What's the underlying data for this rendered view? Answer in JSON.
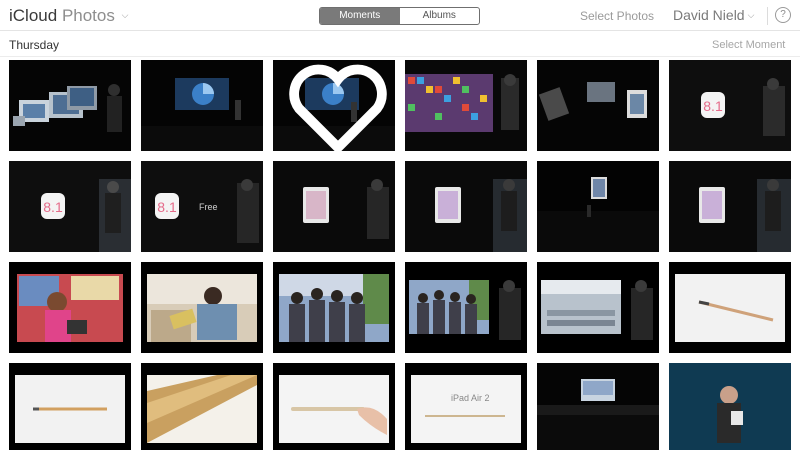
{
  "header": {
    "brand_icloud": "iCloud",
    "brand_app": "Photos",
    "tabs": [
      {
        "label": "Moments",
        "active": true
      },
      {
        "label": "Albums",
        "active": false
      }
    ],
    "select_photos_label": "Select Photos",
    "user_name": "David Nield",
    "help_icon_glyph": "?"
  },
  "moment": {
    "title": "Thursday",
    "select_label": "Select Moment"
  },
  "photos": [
    {
      "desc": "presenter with Mac devices on stage"
    },
    {
      "desc": "stage with blue chart"
    },
    {
      "desc": "stage with blue chart, heart favorite",
      "favorite": true
    },
    {
      "desc": "wall of app icons with presenter"
    },
    {
      "desc": "devices collage with presenter"
    },
    {
      "desc": "iOS 8.1 logo with presenter"
    },
    {
      "desc": "iOS 8.1 logo with presenter"
    },
    {
      "desc": "iOS 8.1 Free",
      "caption": "Free"
    },
    {
      "desc": "iPad with presenter"
    },
    {
      "desc": "iPad with presenter"
    },
    {
      "desc": "wide stage shot with iPad"
    },
    {
      "desc": "iPad with presenter"
    },
    {
      "desc": "child in classroom"
    },
    {
      "desc": "woman on sofa with tablet"
    },
    {
      "desc": "group of people outdoors"
    },
    {
      "desc": "group of people with presenter"
    },
    {
      "desc": "factory interior with presenter"
    },
    {
      "desc": "pencil on white"
    },
    {
      "desc": "pencil on white"
    },
    {
      "desc": "gold edge close-up"
    },
    {
      "desc": "hand holding thin iPad"
    },
    {
      "desc": "iPad Air 2 text on white",
      "caption": "iPad Air 2"
    },
    {
      "desc": "wide stage shot"
    },
    {
      "desc": "presenter holding iPad"
    }
  ]
}
